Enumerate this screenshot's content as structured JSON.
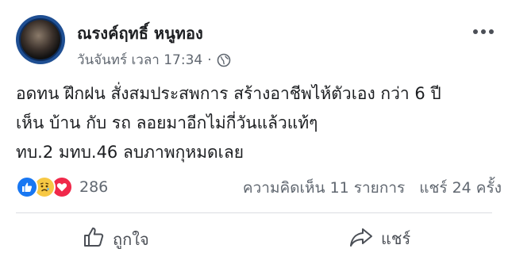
{
  "post": {
    "author": "ณรงค์ฤทธิ์ หนูทอง",
    "timestamp": "วันจันทร์ เวลา 17:34",
    "separator": "·",
    "privacy_icon": "globe-icon",
    "lines": [
      "อดทน ฝึกฝน สั่งสมประสพการ สร้างอาชีพไห้ตัวเอง กว่า 6 ปี",
      "เห็น บ้าน กับ รถ ลอยมาอีกไม่กี่วันแล้วแท้ๆ",
      "ทบ.2 มทบ.46 ลบภาพกุหมดเลย"
    ]
  },
  "reactions": {
    "icons": [
      "like-icon",
      "sad-icon",
      "love-icon"
    ],
    "count": "286"
  },
  "stats": {
    "comments": "ความคิดเห็น 11 รายการ",
    "shares": "แชร์ 24 ครั้ง"
  },
  "actions": {
    "like_label": "ถูกใจ",
    "share_label": "แชร์"
  },
  "colors": {
    "like_blue": "#1877f2",
    "love_red": "#f0284a",
    "sad_yellow": "#f7c844",
    "secondary_text": "#606770"
  }
}
